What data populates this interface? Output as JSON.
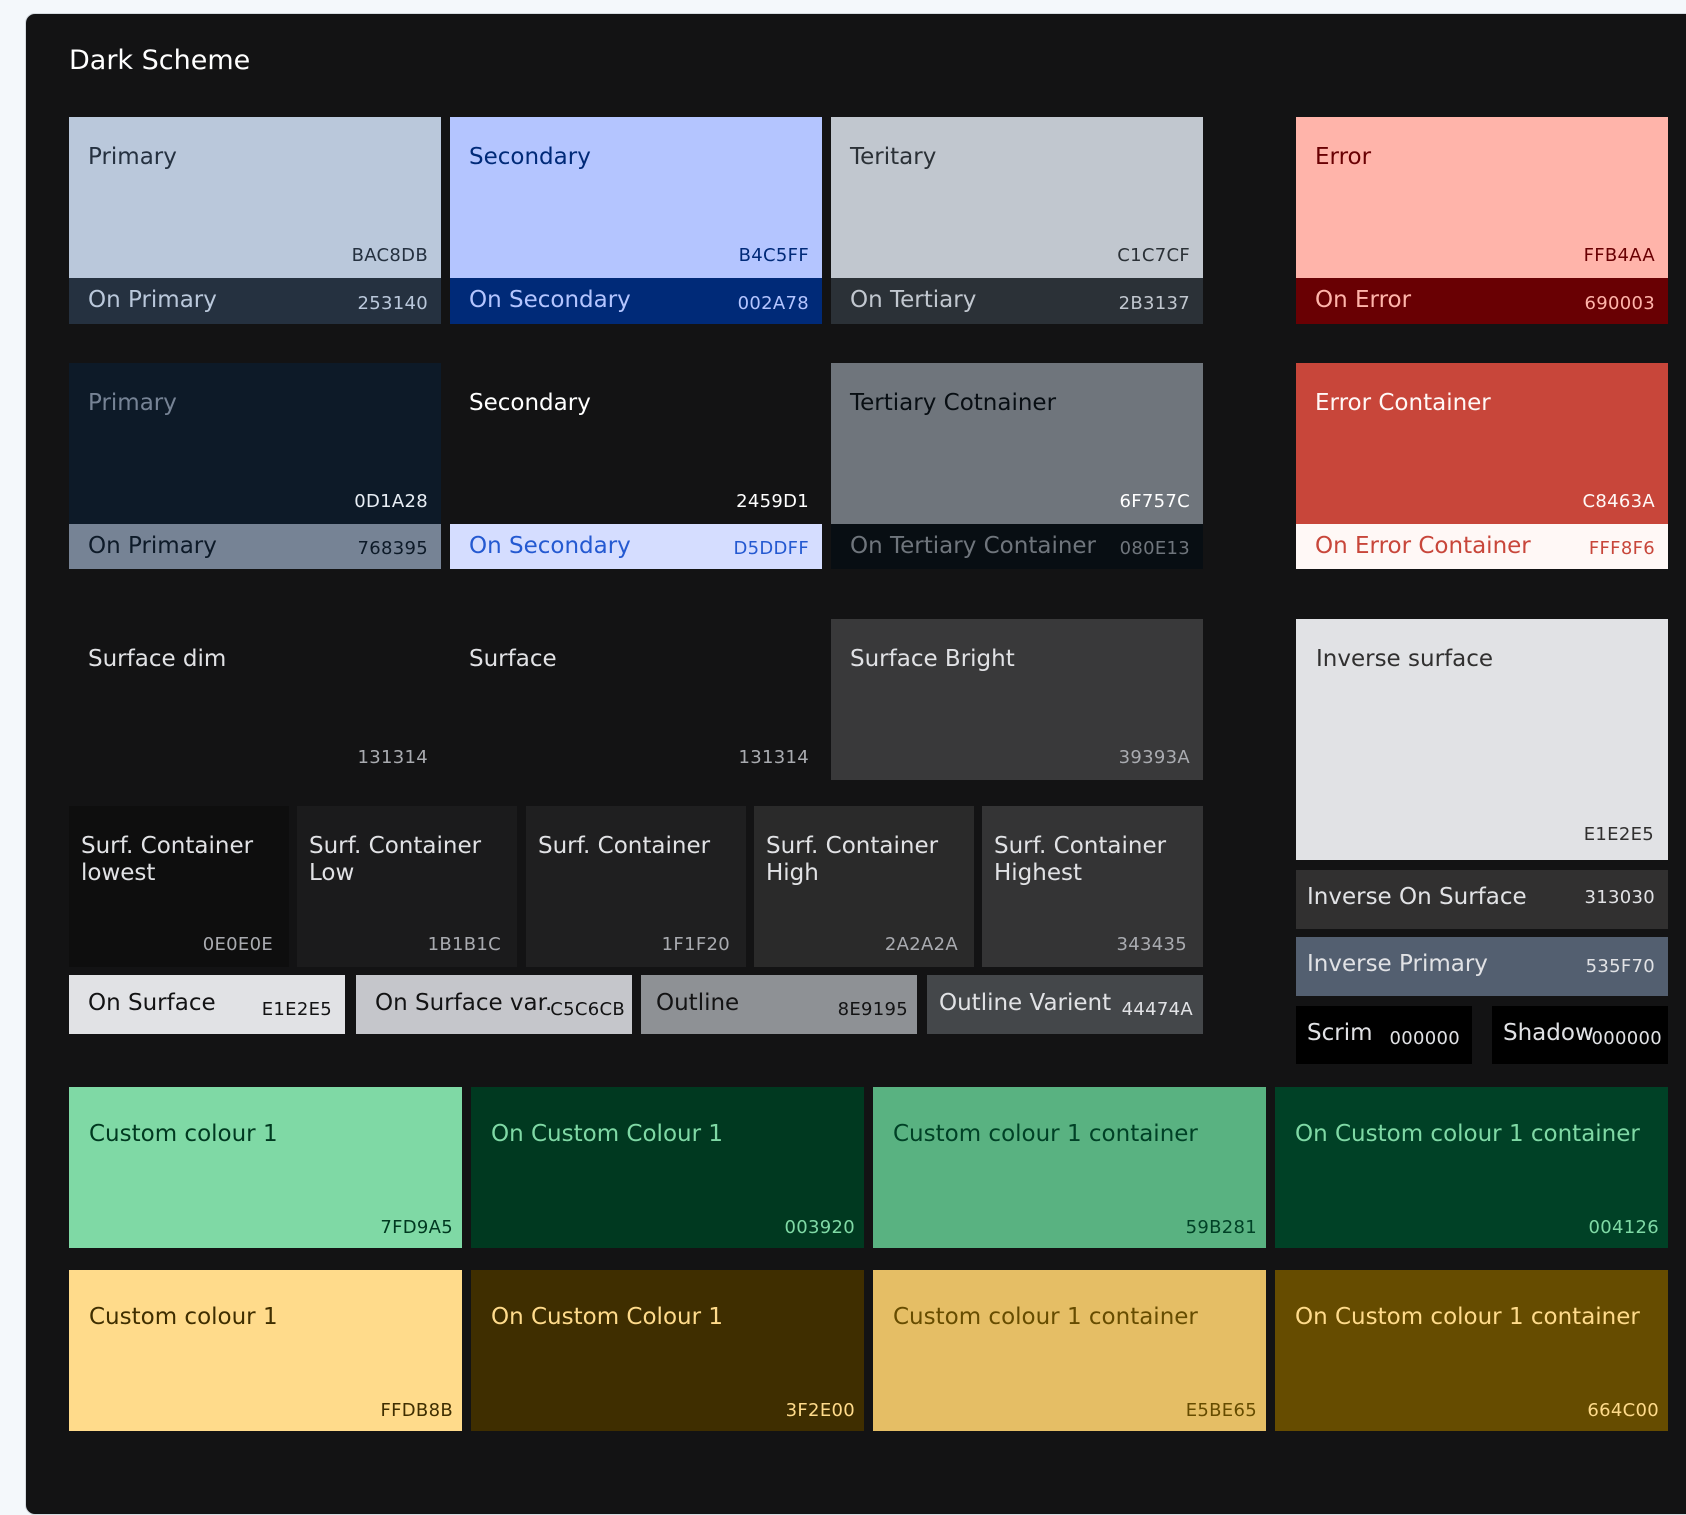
{
  "title": "Dark Scheme",
  "swatches": {
    "primary": {
      "label": "Primary",
      "hex": "BAC8DB"
    },
    "on_primary": {
      "label": "On Primary",
      "hex": "253140"
    },
    "secondary": {
      "label": "Secondary",
      "hex": "B4C5FF"
    },
    "on_secondary": {
      "label": "On Secondary",
      "hex": "002A78"
    },
    "tertiary": {
      "label": "Teritary",
      "hex": "C1C7CF"
    },
    "on_tertiary": {
      "label": "On Tertiary",
      "hex": "2B3137"
    },
    "error": {
      "label": "Error",
      "hex": "FFB4AA"
    },
    "on_error": {
      "label": "On Error",
      "hex": "690003"
    },
    "primary_container": {
      "label": "Primary",
      "hex": "0D1A28"
    },
    "on_primary_container": {
      "label": "On Primary",
      "hex": "768395"
    },
    "secondary_container": {
      "label": "Secondary",
      "hex": "2459D1"
    },
    "on_secondary_container": {
      "label": "On Secondary",
      "hex": "D5DDFF"
    },
    "tertiary_container": {
      "label": "Tertiary Cotnainer",
      "hex": "6F757C"
    },
    "on_tertiary_container": {
      "label": "On Tertiary Container",
      "hex": "080E13"
    },
    "error_container": {
      "label": "Error Container",
      "hex": "C8463A"
    },
    "on_error_container": {
      "label": "On Error Container",
      "hex": "FFF8F6"
    },
    "surface_dim": {
      "label": "Surface dim",
      "hex": "131314"
    },
    "surface": {
      "label": "Surface",
      "hex": "131314"
    },
    "surface_bright": {
      "label": "Surface Bright",
      "hex": "39393A"
    },
    "inverse_surface": {
      "label": "Inverse surface",
      "hex": "E1E2E5"
    },
    "surf_container_lowest": {
      "label": "Surf. Container lowest",
      "hex": "0E0E0E"
    },
    "surf_container_low": {
      "label": "Surf. Container Low",
      "hex": "1B1B1C"
    },
    "surf_container": {
      "label": "Surf. Container",
      "hex": "1F1F20"
    },
    "surf_container_high": {
      "label": "Surf. Container High",
      "hex": "2A2A2A"
    },
    "surf_container_highest": {
      "label": "Surf. Container Highest",
      "hex": "343435"
    },
    "inverse_on_surface": {
      "label": "Inverse On Surface",
      "hex": "313030"
    },
    "inverse_primary": {
      "label": "Inverse Primary",
      "hex": "535F70"
    },
    "on_surface": {
      "label": "On Surface",
      "hex": "E1E2E5"
    },
    "on_surface_var": {
      "label": "On Surface var.",
      "hex": "C5C6CB"
    },
    "outline": {
      "label": "Outline",
      "hex": "8E9195"
    },
    "outline_variant": {
      "label": "Outline Varient",
      "hex": "44474A"
    },
    "scrim": {
      "label": "Scrim",
      "hex": "000000"
    },
    "shadow": {
      "label": "Shadow",
      "hex": "000000"
    },
    "custom1": {
      "label": "Custom colour 1",
      "hex": "7FD9A5"
    },
    "on_custom1": {
      "label": "On Custom Colour 1",
      "hex": "003920"
    },
    "custom1_container": {
      "label": "Custom colour 1 container",
      "hex": "59B281"
    },
    "on_custom1_container": {
      "label": "On Custom colour 1 container",
      "hex": "004126"
    },
    "custom2": {
      "label": "Custom colour 1",
      "hex": "FFDB8B"
    },
    "on_custom2": {
      "label": "On Custom Colour 1",
      "hex": "3F2E00"
    },
    "custom2_container": {
      "label": "Custom colour 1 container",
      "hex": "E5BE65"
    },
    "on_custom2_container": {
      "label": "On Custom colour 1 container",
      "hex": "664C00"
    }
  }
}
